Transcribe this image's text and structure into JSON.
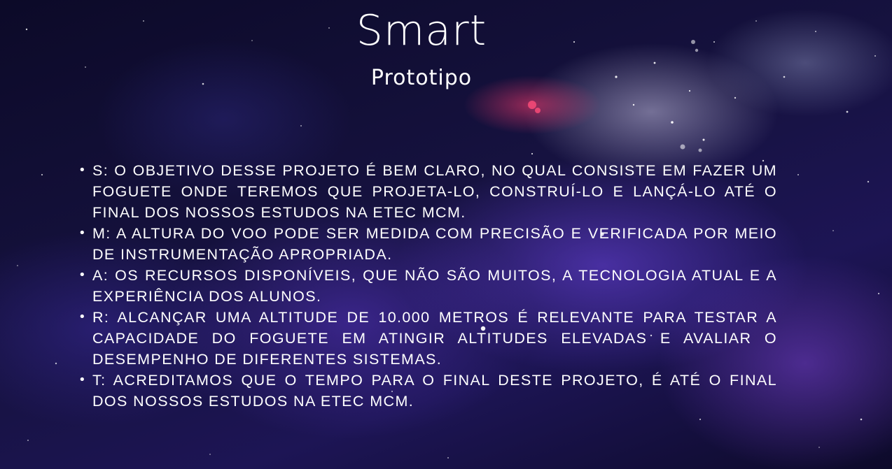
{
  "title": "Smart",
  "subtitle": "Prototipo",
  "items": [
    {
      "text": "S: O OBJETIVO DESSE PROJETO É BEM CLARO, NO QUAL CONSISTE EM FAZER UM FOGUETE ONDE TEREMOS QUE PROJETA-LO, CONSTRUÍ-LO E LANÇÁ-LO ATÉ O FINAL DOS NOSSOS ESTUDOS NA ETEC MCM."
    },
    {
      "text": "M: A ALTURA DO VOO PODE SER MEDIDA COM PRECISÃO E VERIFICADA POR MEIO DE INSTRUMENTAÇÃO APROPRIADA."
    },
    {
      "text": "A: OS RECURSOS DISPONÍVEIS, QUE NÃO SÃO MUITOS, A TECNOLOGIA ATUAL E A EXPERIÊNCIA DOS ALUNOS."
    },
    {
      "text": "R: ALCANÇAR UMA ALTITUDE DE 10.000 METROS É RELEVANTE PARA TESTAR A CAPACIDADE DO FOGUETE EM ATINGIR ALTITUDES ELEVADAS E AVALIAR O DESEMPENHO DE DIFERENTES SISTEMAS."
    },
    {
      "text": "T: ACREDITAMOS QUE O TEMPO PARA O FINAL DESTE PROJETO, É ATÉ O FINAL DOS NOSSOS ESTUDOS NA ETEC MCM."
    }
  ]
}
